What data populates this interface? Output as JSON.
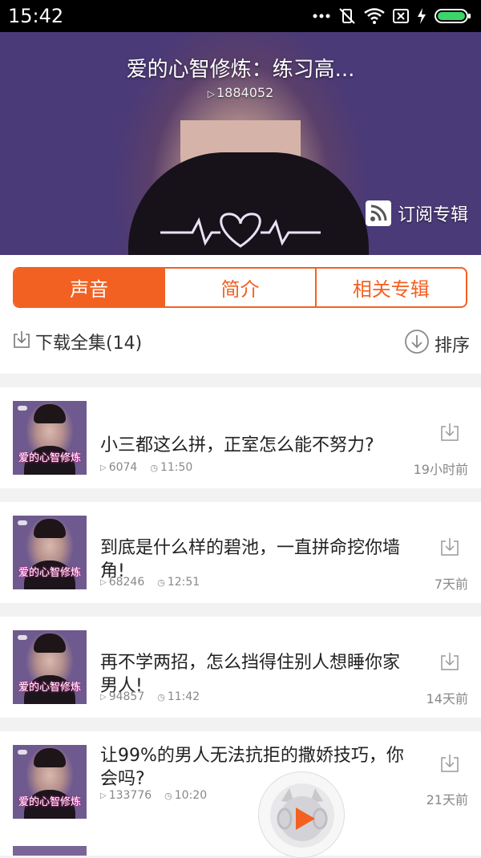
{
  "status_bar": {
    "time": "15:42",
    "icons": [
      "more-icon",
      "vibrate-off-icon",
      "wifi-icon",
      "sim-x-icon",
      "charging-icon",
      "battery-icon"
    ]
  },
  "album": {
    "title": "爱的心智修炼：练习高...",
    "plays": "1884052",
    "subscribe_label": "订阅专辑"
  },
  "tabs": [
    {
      "label": "声音",
      "active": true
    },
    {
      "label": "简介",
      "active": false
    },
    {
      "label": "相关专辑",
      "active": false
    }
  ],
  "toolbar": {
    "download_all_label": "下载全集(14)",
    "sort_label": "排序"
  },
  "tracks": [
    {
      "cover_text": "爱的心智修炼",
      "title": "小三都这么拼，正室怎么能不努力?",
      "plays": "6074",
      "duration": "11:50",
      "time_ago": "19小时前"
    },
    {
      "cover_text": "爱的心智修炼",
      "title": "到底是什么样的碧池，一直拼命挖你墙角!",
      "plays": "68246",
      "duration": "12:51",
      "time_ago": "7天前"
    },
    {
      "cover_text": "爱的心智修炼",
      "title": "再不学两招，怎么挡得住别人想睡你家男人!",
      "plays": "94857",
      "duration": "11:42",
      "time_ago": "14天前"
    },
    {
      "cover_text": "爱的心智修炼",
      "title": "让99%的男人无法抗拒的撒娇技巧，你会吗?",
      "plays": "133776",
      "duration": "10:20",
      "time_ago": "21天前"
    }
  ],
  "colors": {
    "accent": "#f26122",
    "text": "#222222",
    "meta": "#888888"
  }
}
